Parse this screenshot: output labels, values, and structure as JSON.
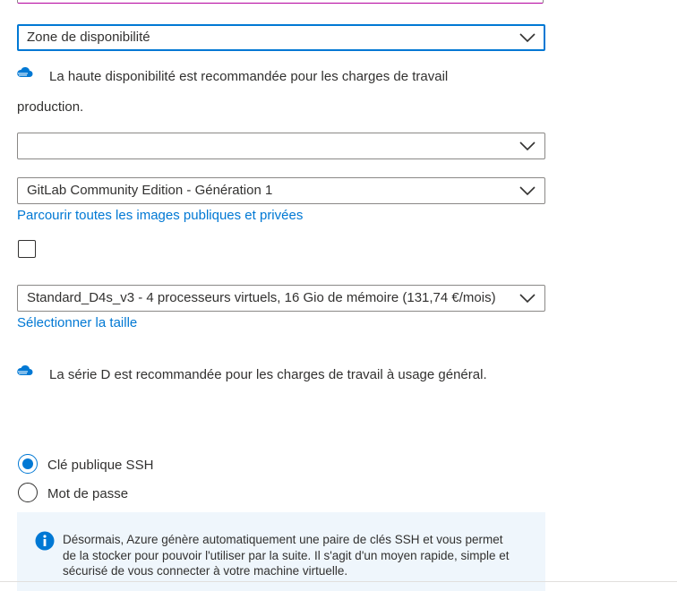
{
  "availability": {
    "selected": "Zone de disponibilité"
  },
  "ha_note": {
    "line1": "La haute disponibilité est recommandée pour les charges de travail",
    "line2": "production."
  },
  "empty_select": {
    "selected": ""
  },
  "image": {
    "selected": "GitLab Community Edition - Génération 1",
    "browse_link": "Parcourir toutes les images publiques et privées"
  },
  "size": {
    "selected": "Standard_D4s_v3 - 4 processeurs virtuels, 16 Gio de mémoire (131,74 €/mois)",
    "select_link": "Sélectionner la taille"
  },
  "d_series_note": "La série D est recommandée pour les charges de travail à usage général.",
  "auth": {
    "options": [
      {
        "label": "Clé publique SSH",
        "checked": true
      },
      {
        "label": "Mot de passe",
        "checked": false
      }
    ]
  },
  "infobox": {
    "text": "Désormais, Azure génère automatiquement une paire de clés SSH et vous permet de la stocker pour pouvoir l'utiliser par la suite. Il s'agit d'un moyen rapide, simple et sécurisé de vous connecter à votre machine virtuelle."
  },
  "colors": {
    "accent": "#0078d4",
    "info_bg": "#eff6fc",
    "text": "#323130",
    "border": "#8a8886"
  },
  "icons": [
    "chevron-down-icon",
    "cloud-icon",
    "info-icon"
  ]
}
